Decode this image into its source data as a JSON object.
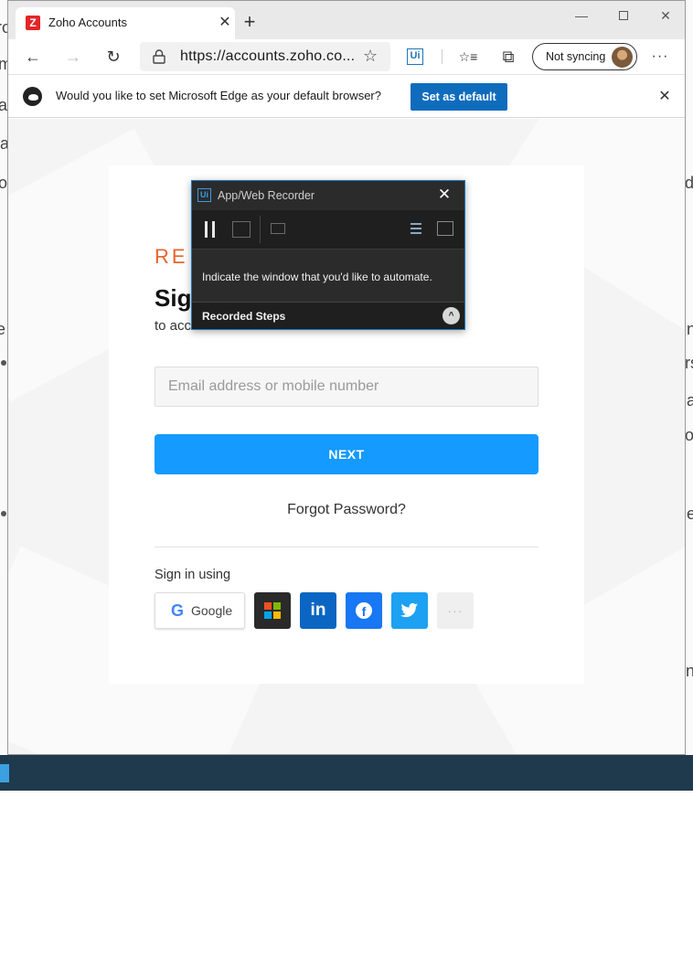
{
  "tab": {
    "title": "Zoho Accounts",
    "favicon_letter": "Z",
    "close_glyph": "✕",
    "new_tab_glyph": "+"
  },
  "window_controls": {
    "minimize_glyph": "—",
    "close_glyph": "✕"
  },
  "toolbar": {
    "back_glyph": "←",
    "forward_glyph": "→",
    "refresh_glyph": "↻",
    "url": "https://accounts.zoho.co...",
    "star_glyph": "☆",
    "extension_label": "Ui",
    "favorites_glyph": "☆≡",
    "collections_glyph": "⧉",
    "profile_text": "Not syncing",
    "menu_glyph": "···"
  },
  "infobar": {
    "message": "Would you like to set Microsoft Edge as your default browser?",
    "button_label": "Set as default",
    "close_glyph": "✕"
  },
  "signin": {
    "brand_partial": "RE",
    "heading_partial": "Sign",
    "subheading_partial": "to acc",
    "email_placeholder": "Email address or mobile number",
    "next_label": "NEXT",
    "forgot_label": "Forgot Password?",
    "sign_in_using_label": "Sign in using",
    "google_label": "Google",
    "google_glyph": "G",
    "linkedin_glyph": "in",
    "facebook_glyph": "f",
    "more_glyph": "···"
  },
  "recorder": {
    "app_icon_label": "Ui",
    "title": "App/Web Recorder",
    "close_glyph": "✕",
    "instruction": "Indicate the window that you'd like to automate.",
    "steps_label": "Recorded Steps",
    "expand_glyph": "^"
  },
  "background_fragments": {
    "left": [
      "ro",
      "m",
      "a",
      "ra",
      "o",
      "e"
    ],
    "right": [
      "d",
      "n",
      "rs",
      "a",
      "or",
      "e",
      "n"
    ]
  },
  "colors": {
    "brand_orange": "#e8632b",
    "next_blue": "#159aff",
    "edge_blue": "#0f6cbd",
    "recorder_border": "#1c75bc",
    "linkedin": "#0a66c2",
    "facebook": "#1877f2",
    "twitter": "#1da1f2"
  }
}
